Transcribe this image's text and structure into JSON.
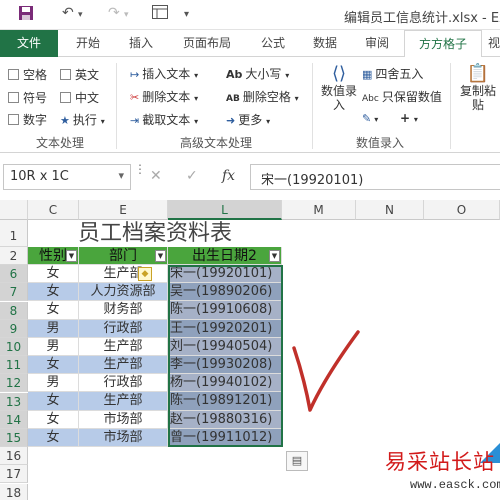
{
  "window": {
    "title": "编辑员工信息统计.xlsx - Exc"
  },
  "quick_access": {
    "save_icon": "save-icon",
    "undo_icon": "undo-icon",
    "redo_icon": "redo-icon",
    "form_icon": "form-icon"
  },
  "tabs": [
    "文件",
    "开始",
    "插入",
    "页面布局",
    "公式",
    "数据",
    "审阅",
    "方方格子",
    "视"
  ],
  "ribbon": {
    "text_group": {
      "label": "文本处理",
      "checkboxes": [
        "空格",
        "英文",
        "符号",
        "中文",
        "数字"
      ],
      "execute": "执行"
    },
    "adv_group": {
      "label": "高级文本处理",
      "items": [
        "插入文本",
        "删除文本",
        "截取文本",
        "大小写",
        "删除空格",
        "更多"
      ]
    },
    "data_group": {
      "label": "数值录入",
      "big_button": "数值录入",
      "items": [
        "四舍五入",
        "只保留数值"
      ],
      "paste": "复制粘贴"
    }
  },
  "formula_bar": {
    "name_box": "10R x 1C",
    "cancel": "✕",
    "enter": "✓",
    "fx": "fx",
    "content": "宋一(19920101)"
  },
  "columns": [
    "C",
    "E",
    "L",
    "M",
    "N",
    "O"
  ],
  "rows": [
    "1",
    "2",
    "6",
    "7",
    "8",
    "9",
    "10",
    "11",
    "12",
    "13",
    "14",
    "15",
    "16",
    "17",
    "18"
  ],
  "sheet": {
    "title": "员工档案资料表",
    "headers": [
      "性别",
      "部门",
      "出生日期2"
    ],
    "data": [
      [
        "女",
        "生产部",
        "宋一(19920101)"
      ],
      [
        "女",
        "人力资源部",
        "吴一(19890206)"
      ],
      [
        "女",
        "财务部",
        "陈一(19910608)"
      ],
      [
        "男",
        "行政部",
        "王一(19920201)"
      ],
      [
        "男",
        "生产部",
        "刘一(19940504)"
      ],
      [
        "女",
        "生产部",
        "李一(19930208)"
      ],
      [
        "男",
        "行政部",
        "杨一(19940102)"
      ],
      [
        "女",
        "生产部",
        "陈一(19891201)"
      ],
      [
        "女",
        "市场部",
        "赵一(19880316)"
      ],
      [
        "女",
        "市场部",
        "曾一(19911012)"
      ]
    ]
  },
  "watermark": {
    "cn": "易采站长站",
    "url": "www.easck.com"
  },
  "colors": {
    "excel_green": "#217346",
    "header_green": "#4aa53d",
    "band_blue": "#b7cbe8",
    "check_red": "#c0302a"
  }
}
